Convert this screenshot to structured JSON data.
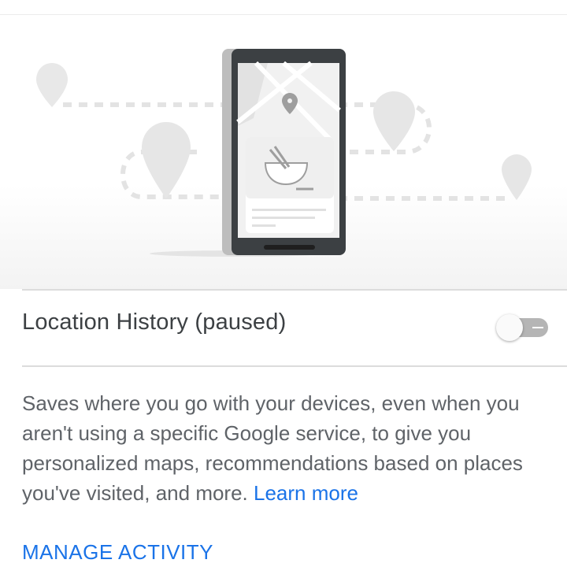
{
  "setting": {
    "title": "Location History (paused)",
    "enabled": false
  },
  "description": {
    "text": "Saves where you go with your devices, even when you aren't using a specific Google service, to give you personalized maps, recommendations based on places you've visited, and more.",
    "link_label": "Learn more"
  },
  "actions": {
    "manage_label": "MANAGE ACTIVITY"
  },
  "colors": {
    "accent": "#1a73e8",
    "title_text": "#3c4043",
    "body_text": "#5f6368",
    "toggle_track_off": "#b5b5b5"
  },
  "icons": [
    "location-pin-icon",
    "phone-illustration",
    "food-bowl-icon"
  ]
}
